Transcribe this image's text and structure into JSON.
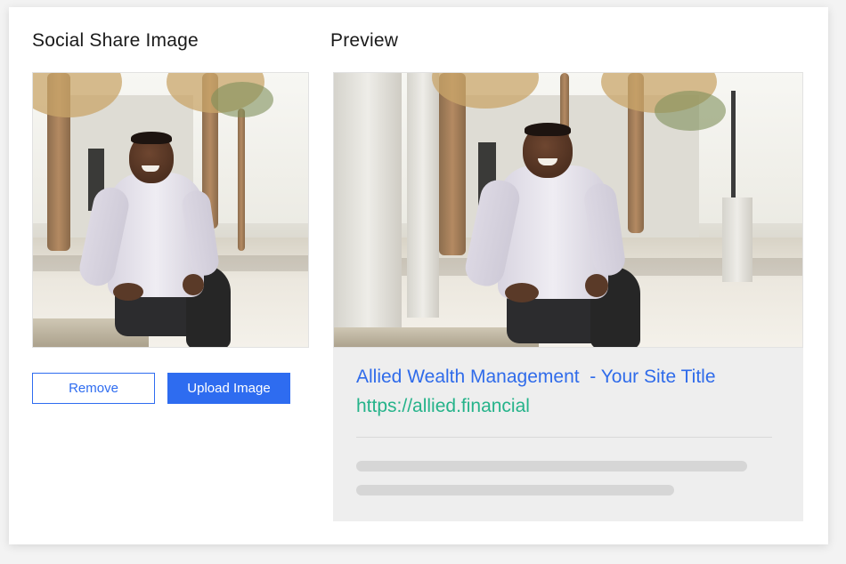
{
  "left_panel": {
    "title": "Social Share Image",
    "remove_label": "Remove",
    "upload_label": "Upload Image"
  },
  "right_panel": {
    "title": "Preview",
    "site_title": "Allied Wealth Management  - Your Site Title",
    "site_url": "https://allied.financial"
  },
  "colors": {
    "accent_blue": "#2e6cf0",
    "url_green": "#25b38a",
    "meta_background": "#eeeeee"
  }
}
